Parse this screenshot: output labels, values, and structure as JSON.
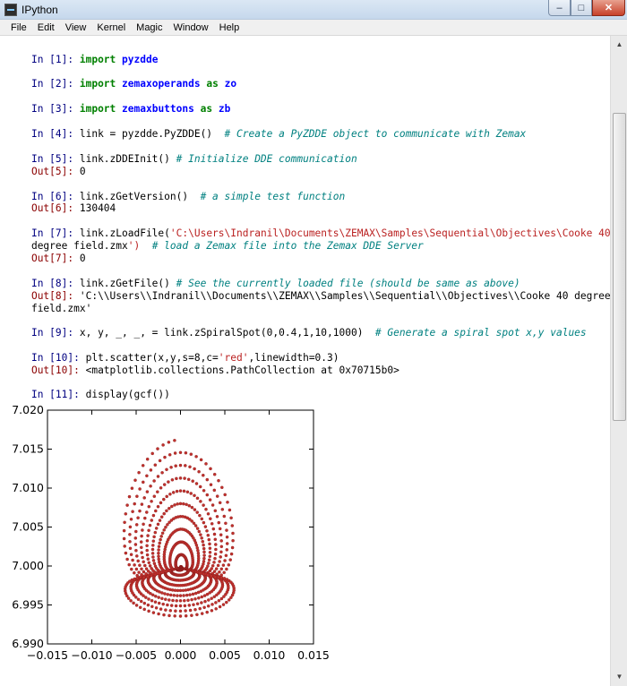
{
  "window": {
    "title": "IPython",
    "buttons": {
      "minimize": "–",
      "maximize": "□",
      "close": "✕"
    }
  },
  "menu": [
    "File",
    "Edit",
    "View",
    "Kernel",
    "Magic",
    "Window",
    "Help"
  ],
  "cells": [
    {
      "prompt": "In [1]:",
      "code": "import pyzdde"
    },
    {
      "prompt": "In [2]:",
      "code": "import zemaxoperands as zo"
    },
    {
      "prompt": "In [3]:",
      "code": "import zemaxbuttons as zb"
    },
    {
      "prompt": "In [4]:",
      "code": "link = pyzdde.PyZDDE()  # Create a PyZDDE object to communicate with Zemax"
    },
    {
      "prompt": "In [5]:",
      "code": "link.zDDEInit() # Initialize DDE communication",
      "out_prompt": "Out[5]:",
      "out": "0"
    },
    {
      "prompt": "In [6]:",
      "code": "link.zGetVersion()  # a simple test function",
      "out_prompt": "Out[6]:",
      "out": "130404"
    },
    {
      "prompt": "In [7]:",
      "code_line1": "link.zLoadFile('C:\\Users\\Indranil\\Documents\\ZEMAX\\Samples\\Sequential\\Objectives\\Cooke 40",
      "code_line2": "degree field.zmx')  # load a Zemax file into the Zemax DDE Server",
      "out_prompt": "Out[7]:",
      "out": "0"
    },
    {
      "prompt": "In [8]:",
      "code": "link.zGetFile() # See the currently loaded file (should be same as above)",
      "out_prompt": "Out[8]:",
      "out_line1": "'C:\\\\Users\\\\Indranil\\\\Documents\\\\ZEMAX\\\\Samples\\\\Sequential\\\\Objectives\\\\Cooke 40 degree",
      "out_line2": "field.zmx'"
    },
    {
      "prompt": "In [9]:",
      "code": "x, y, _, _, = link.zSpiralSpot(0,0.4,1,10,1000)  # Generate a spiral spot x,y values"
    },
    {
      "prompt": "In [10]:",
      "code": "plt.scatter(x,y,s=8,c='red',linewidth=0.3)",
      "out_prompt": "Out[10]:",
      "out": "<matplotlib.collections.PathCollection at 0x70715b0>"
    },
    {
      "prompt": "In [11]:",
      "code": "display(gcf())"
    }
  ],
  "chart_data": {
    "type": "scatter",
    "title": "",
    "xlabel": "",
    "ylabel": "",
    "xlim": [
      -0.015,
      0.015
    ],
    "ylim": [
      6.99,
      7.02
    ],
    "xticks": [
      "−0.015",
      "−0.010",
      "−0.005",
      "0.000",
      "0.005",
      "0.010",
      "0.015"
    ],
    "yticks": [
      "6.990",
      "6.995",
      "7.000",
      "7.005",
      "7.010",
      "7.015",
      "7.020"
    ],
    "series": [
      {
        "color": "#c0302c",
        "description_points": "spiral spot; approx. range x -0.011..0.0105, y 6.9932..7.0162",
        "x_extent": [
          -0.011,
          0.0105
        ],
        "y_extent": [
          6.9932,
          7.0162
        ],
        "center": [
          0.0,
          6.9998
        ]
      }
    ],
    "grid": false
  }
}
